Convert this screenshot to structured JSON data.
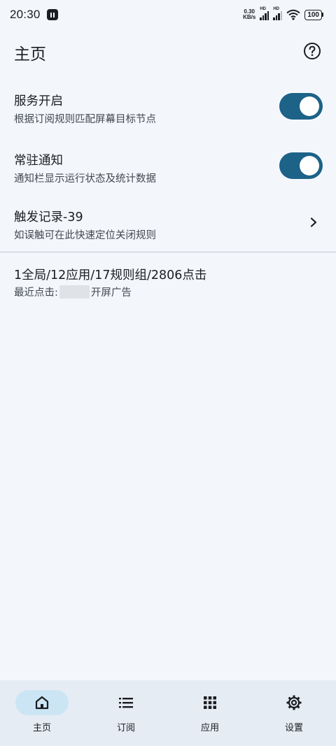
{
  "status_bar": {
    "time": "20:30",
    "net_speed_value": "0.30",
    "net_speed_unit": "KB/s",
    "signal_label_1": "HD",
    "signal_label_2": "HD",
    "battery": "100"
  },
  "header": {
    "title": "主页",
    "help_icon": "help-circle-icon"
  },
  "settings": [
    {
      "title": "服务开启",
      "subtitle": "根据订阅规则匹配屏幕目标节点",
      "toggle_on": true
    },
    {
      "title": "常驻通知",
      "subtitle": "通知栏显示运行状态及统计数据",
      "toggle_on": true
    },
    {
      "title": "触发记录-39",
      "subtitle": "如误触可在此快速定位关闭规则",
      "icon": "chevron-right-icon"
    }
  ],
  "stats": {
    "summary": "1全局/12应用/17规则组/2806点击",
    "last_click_label": "最近点击:",
    "last_click_rule": "开屏广告"
  },
  "colors": {
    "accent": "#1d6287",
    "background": "#f3f7fc",
    "nav_background": "#e5ecf4",
    "active_pill": "#cce5f5"
  },
  "bottom_nav": [
    {
      "label": "主页",
      "icon": "home-icon",
      "active": true
    },
    {
      "label": "订阅",
      "icon": "list-icon",
      "active": false
    },
    {
      "label": "应用",
      "icon": "apps-grid-icon",
      "active": false
    },
    {
      "label": "设置",
      "icon": "gear-icon",
      "active": false
    }
  ]
}
